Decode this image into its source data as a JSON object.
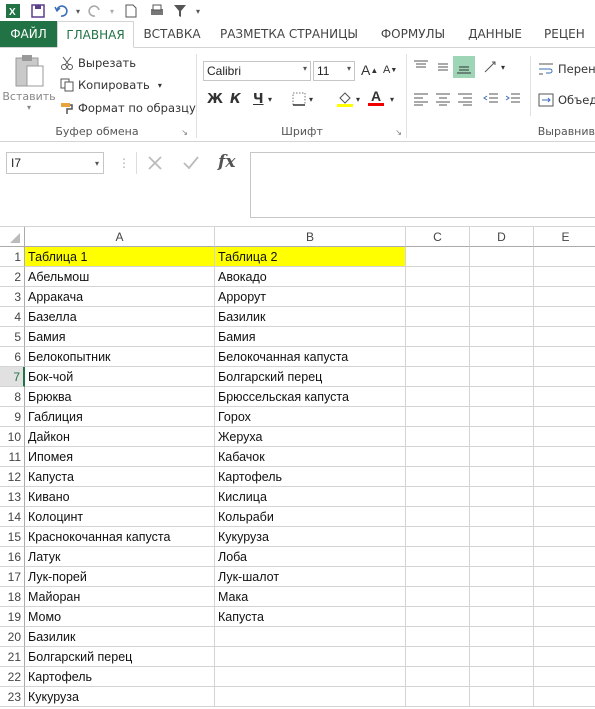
{
  "quick_access": {
    "icons": [
      "excel-logo-icon",
      "save-icon",
      "undo-icon",
      "redo-icon",
      "new-file-icon",
      "print-preview-icon",
      "filter-icon",
      "customize-qat-icon"
    ]
  },
  "tabs": [
    "ФАЙЛ",
    "ГЛАВНАЯ",
    "ВСТАВКА",
    "РАЗМЕТКА СТРАНИЦЫ",
    "ФОРМУЛЫ",
    "ДАННЫЕ",
    "РЕЦЕН"
  ],
  "active_tab": "ГЛАВНАЯ",
  "ribbon": {
    "clipboard": {
      "paste_label": "Вставить",
      "cut_label": "Вырезать",
      "copy_label": "Копировать",
      "format_painter_label": "Формат по образцу",
      "group_label": "Буфер обмена"
    },
    "font": {
      "font_name": "Calibri",
      "font_size": "11",
      "grow_label": "A",
      "shrink_label": "A",
      "bold_label": "Ж",
      "italic_label": "К",
      "underline_label": "Ч",
      "font_color_label": "A",
      "group_label": "Шрифт"
    },
    "alignment": {
      "wrap_label": "Перен",
      "merge_label": "Объед",
      "group_label": "Выравнив"
    }
  },
  "formula_bar": {
    "name_box": "I7",
    "fx_label": "fx",
    "formula": ""
  },
  "sheet": {
    "columns": [
      "A",
      "B",
      "C",
      "D",
      "E"
    ],
    "selected_row": "7",
    "rows": [
      {
        "n": "1",
        "a": "Таблица 1",
        "b": "Таблица 2"
      },
      {
        "n": "2",
        "a": "Абельмош",
        "b": "Авокадо"
      },
      {
        "n": "3",
        "a": "Арракача",
        "b": "Аррорут"
      },
      {
        "n": "4",
        "a": "Базелла",
        "b": "Базилик"
      },
      {
        "n": "5",
        "a": "Бамия",
        "b": "Бамия"
      },
      {
        "n": "6",
        "a": "Белокопытник",
        "b": "Белокочанная капуста"
      },
      {
        "n": "7",
        "a": "Бок-чой",
        "b": "Болгарский перец"
      },
      {
        "n": "8",
        "a": "Брюква",
        "b": "Брюссельская капуста"
      },
      {
        "n": "9",
        "a": "Габлиция",
        "b": "Горох"
      },
      {
        "n": "10",
        "a": "Дайкон",
        "b": "Жеруха"
      },
      {
        "n": "11",
        "a": "Ипомея",
        "b": "Кабачок"
      },
      {
        "n": "12",
        "a": "Капуста",
        "b": "Картофель"
      },
      {
        "n": "13",
        "a": "Кивано",
        "b": "Кислица"
      },
      {
        "n": "14",
        "a": "Колоцинт",
        "b": "Кольраби"
      },
      {
        "n": "15",
        "a": "Краснокочанная капуста",
        "b": "Кукуруза"
      },
      {
        "n": "16",
        "a": "Латук",
        "b": "Лоба"
      },
      {
        "n": "17",
        "a": "Лук-порей",
        "b": "Лук-шалот"
      },
      {
        "n": "18",
        "a": "Майоран",
        "b": "Мака"
      },
      {
        "n": "19",
        "a": "Момо",
        "b": "Капуста"
      },
      {
        "n": "20",
        "a": "Базилик",
        "b": ""
      },
      {
        "n": "21",
        "a": "Болгарский перец",
        "b": ""
      },
      {
        "n": "22",
        "a": "Картофель",
        "b": ""
      },
      {
        "n": "23",
        "a": "Кукуруза",
        "b": ""
      }
    ]
  },
  "colors": {
    "accent": "#217346",
    "header_fill": "#ffff00"
  }
}
